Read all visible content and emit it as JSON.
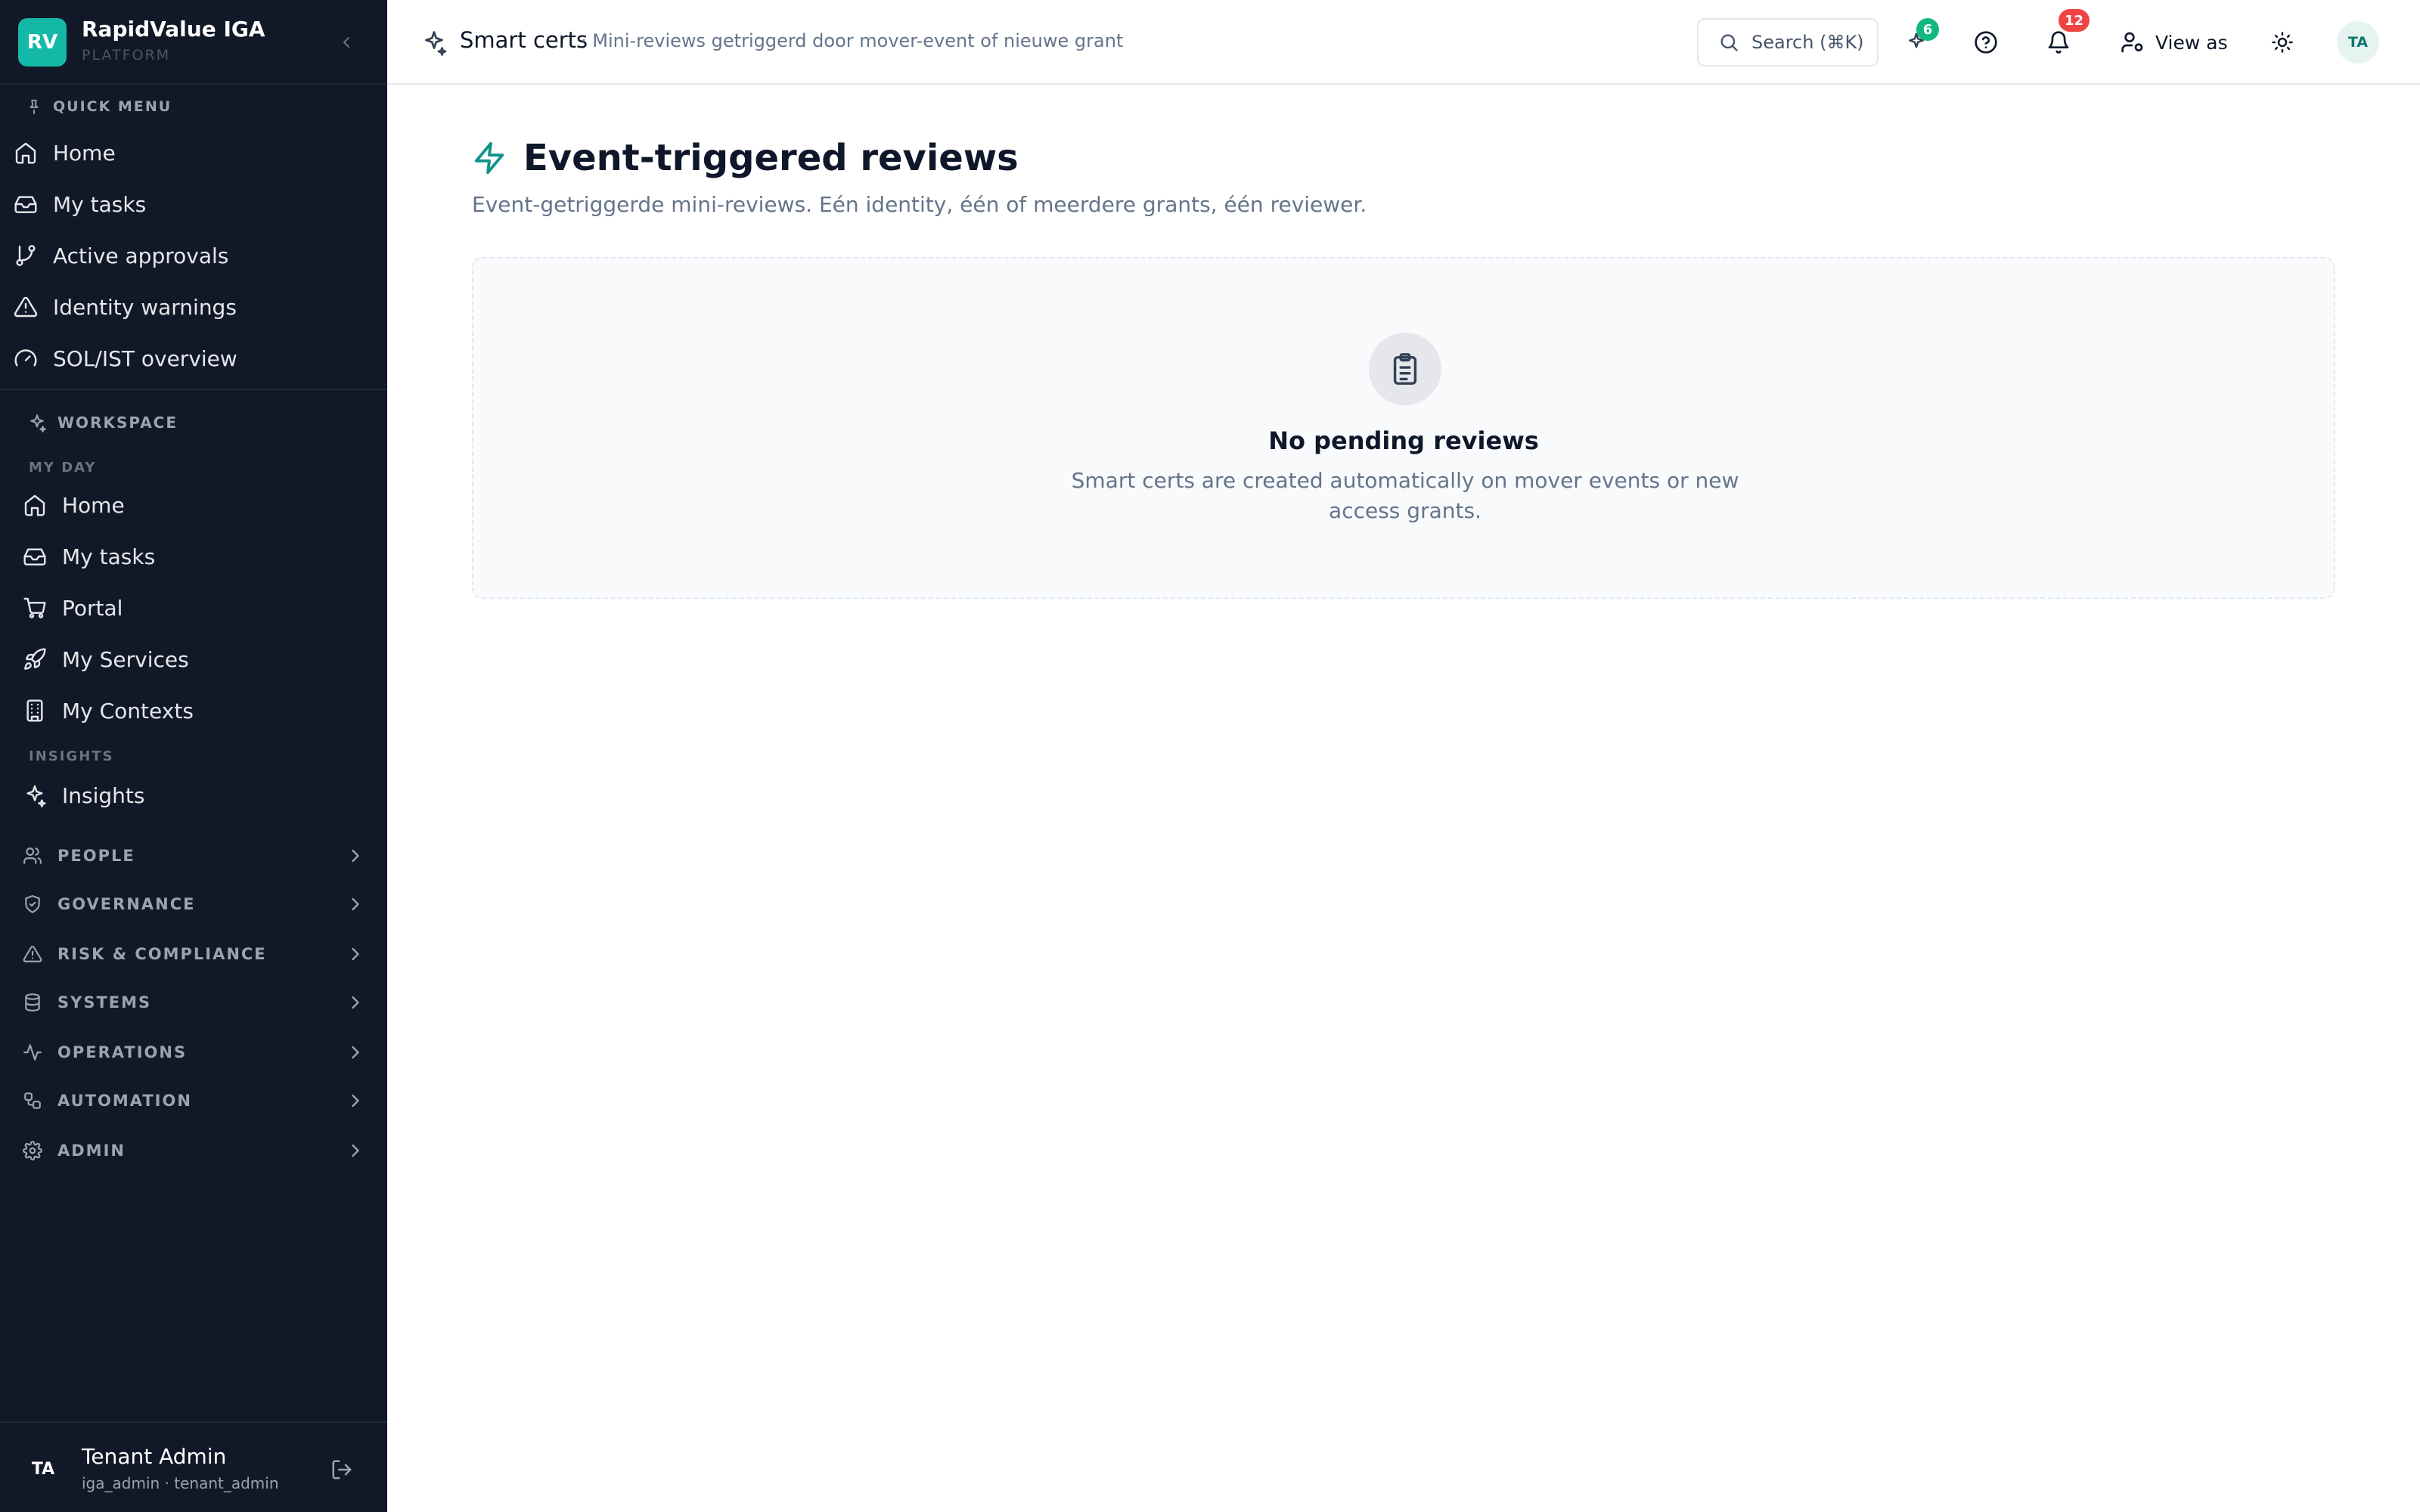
{
  "brand": {
    "logo_text": "RV",
    "name": "RapidValue IGA",
    "sub": "PLATFORM"
  },
  "quick_menu": {
    "label": "QUICK MENU",
    "items": [
      {
        "label": "Home",
        "icon": "home-icon"
      },
      {
        "label": "My tasks",
        "icon": "inbox-icon"
      },
      {
        "label": "Active approvals",
        "icon": "git-branch-icon"
      },
      {
        "label": "Identity warnings",
        "icon": "warning-icon"
      },
      {
        "label": "SOL/IST overview",
        "icon": "gauge-icon"
      }
    ]
  },
  "workspace": {
    "label": "WORKSPACE",
    "my_day_label": "MY DAY",
    "my_day_items": [
      {
        "label": "Home",
        "icon": "home-icon"
      },
      {
        "label": "My tasks",
        "icon": "inbox-icon"
      },
      {
        "label": "Portal",
        "icon": "cart-icon"
      },
      {
        "label": "My Services",
        "icon": "rocket-icon"
      },
      {
        "label": "My Contexts",
        "icon": "building-icon"
      }
    ],
    "insights_label": "INSIGHTS",
    "insights_items": [
      {
        "label": "Insights",
        "icon": "sparkles-icon"
      }
    ]
  },
  "groups": [
    {
      "label": "PEOPLE",
      "icon": "users-icon"
    },
    {
      "label": "GOVERNANCE",
      "icon": "shield-icon"
    },
    {
      "label": "RISK & COMPLIANCE",
      "icon": "warning-icon"
    },
    {
      "label": "SYSTEMS",
      "icon": "database-icon"
    },
    {
      "label": "OPERATIONS",
      "icon": "activity-icon"
    },
    {
      "label": "AUTOMATION",
      "icon": "workflow-icon"
    },
    {
      "label": "ADMIN",
      "icon": "gear-icon"
    }
  ],
  "user": {
    "initials": "TA",
    "name": "Tenant Admin",
    "meta": "iga_admin · tenant_admin"
  },
  "header": {
    "title": "Smart certs",
    "subtitle": "· Mini-reviews getriggerd door mover-event of nieuwe grant",
    "search_label": "Search (⌘K)",
    "insights_badge": "6",
    "notifications_badge": "12",
    "view_as_label": "View as",
    "avatar_initials": "TA"
  },
  "main": {
    "title": "Event-triggered reviews",
    "description": "Event-getriggerde mini-reviews. Eén identity, één of meerdere grants, één reviewer.",
    "empty_title": "No pending reviews",
    "empty_text": "Smart certs are created automatically on mover events or new access grants."
  },
  "colors": {
    "sidebar_bg": "#111827",
    "accent": "#14b8a6",
    "badge_green": "#10b981",
    "badge_red": "#ef4444"
  }
}
